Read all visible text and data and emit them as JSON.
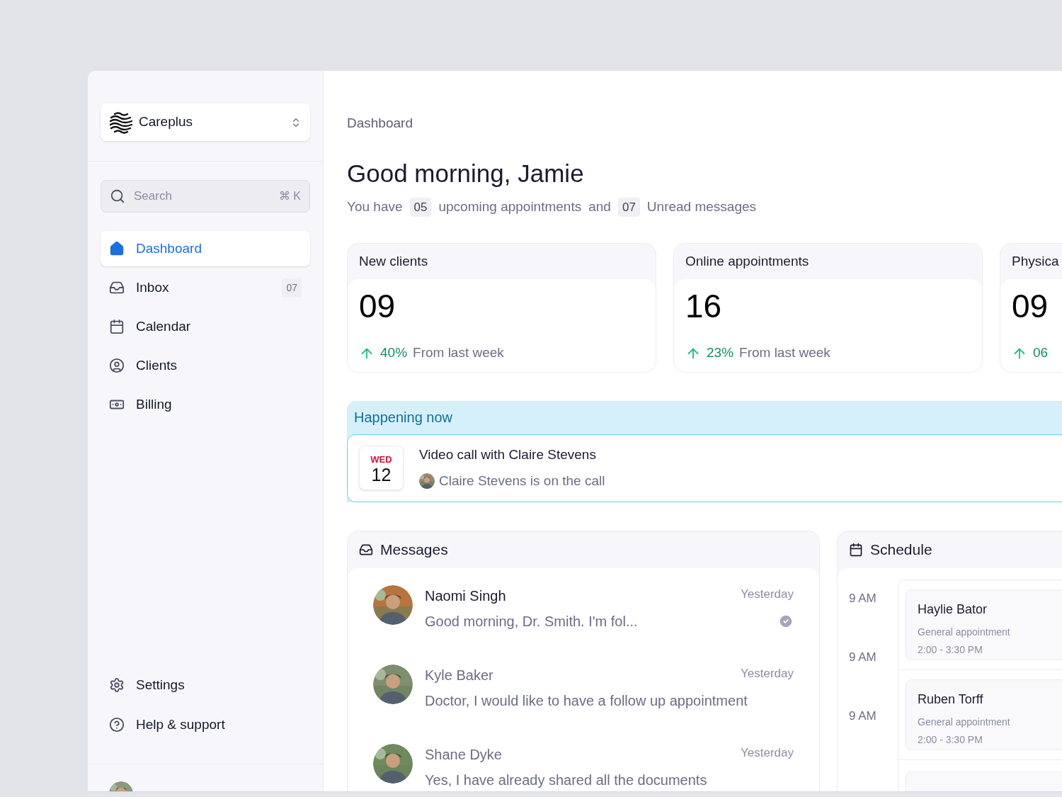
{
  "sidebar": {
    "workspace": {
      "name": "Careplus"
    },
    "search": {
      "placeholder": "Search",
      "shortcut": "⌘ K"
    },
    "nav": [
      {
        "label": "Dashboard",
        "selected": true
      },
      {
        "label": "Inbox",
        "badge": "07",
        "selected": false
      },
      {
        "label": "Calendar",
        "selected": false
      },
      {
        "label": "Clients",
        "selected": false
      },
      {
        "label": "Billing",
        "selected": false
      }
    ],
    "footer_nav": [
      {
        "label": "Settings"
      },
      {
        "label": "Help & support"
      }
    ]
  },
  "breadcrumb": "Dashboard",
  "greeting": "Good morning, Jamie",
  "summary": [
    {
      "kind": "text",
      "text": "You have"
    },
    {
      "kind": "count",
      "text": "05"
    },
    {
      "kind": "text",
      "text": "upcoming appointments"
    },
    {
      "kind": "text",
      "text": "and"
    },
    {
      "kind": "count",
      "text": "07"
    },
    {
      "kind": "text",
      "text": "Unread messages"
    }
  ],
  "stats": [
    {
      "title": "New clients",
      "value": "09",
      "change": "40%",
      "note": "From last week"
    },
    {
      "title": "Online appointments",
      "value": "16",
      "change": "23%",
      "note": "From last week"
    },
    {
      "title": "Physica",
      "value": "09",
      "change": "06"
    }
  ],
  "happening_now": {
    "title": "Happening now",
    "event": {
      "day": "WED",
      "date": "12",
      "title": "Video call with Claire Stevens",
      "subtitle": "Claire Stevens is on the call"
    }
  },
  "messages": {
    "title": "Messages",
    "items": [
      {
        "name": "Naomi Singh",
        "time": "Yesterday",
        "preview": "Good morning, Dr. Smith. I'm fol...",
        "unread": true,
        "seen": true
      },
      {
        "name": "Kyle Baker",
        "time": "Yesterday",
        "preview": "Doctor, I would like to have a follow up appointment",
        "unread": false,
        "seen": false
      },
      {
        "name": "Shane Dyke",
        "time": "Yesterday",
        "preview": "Yes, I have already shared all the documents",
        "unread": false,
        "seen": false
      }
    ]
  },
  "schedule": {
    "title": "Schedule",
    "times": [
      "9 AM",
      "9 AM",
      "9 AM"
    ],
    "appointments": [
      {
        "name": "Haylie Bator",
        "type": "General appointment",
        "time": "2:00 - 3:30 PM"
      },
      {
        "name": "Ruben Torff",
        "type": "General appointment",
        "time": "2:00 - 3:30 PM"
      }
    ]
  }
}
